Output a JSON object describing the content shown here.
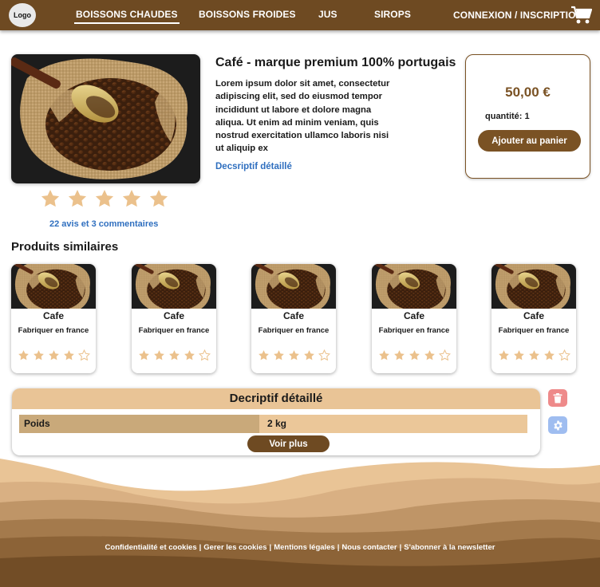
{
  "header": {
    "logo": "Logo",
    "nav": [
      "BOISSONS CHAUDES",
      "BOISSONS FROIDES",
      "JUS",
      "SIROPS"
    ],
    "account": "CONNEXION / INSCRIPTION",
    "cart_icon": "shopping-cart-icon"
  },
  "product": {
    "title": "Café - marque premium 100% portugais",
    "description": "Lorem ipsum dolor sit amet, consectetur adipiscing elit, sed do eiusmod tempor incididunt ut labore et dolore magna aliqua. Ut enim ad minim veniam, quis nostrud exercitation ullamco laboris nisi ut aliquip ex",
    "detail_link": "Decsriptif détaillé",
    "rating": 5,
    "reviews": "22 avis et 3 commentaires",
    "price": "50,00 €",
    "quantity": "quantité: 1",
    "add_to_cart": "Ajouter au panier"
  },
  "similar": {
    "title": "Produits similaires",
    "items": [
      {
        "name": "Cafe",
        "subtitle": "Fabriquer en france",
        "rating": 4
      },
      {
        "name": "Cafe",
        "subtitle": "Fabriquer en france",
        "rating": 4
      },
      {
        "name": "Cafe",
        "subtitle": "Fabriquer en france",
        "rating": 4
      },
      {
        "name": "Cafe",
        "subtitle": "Fabriquer en france",
        "rating": 4
      },
      {
        "name": "Cafe",
        "subtitle": "Fabriquer en france",
        "rating": 4
      }
    ]
  },
  "details": {
    "title": "Decriptif détaillé",
    "rows": [
      {
        "key": "Poids",
        "value": "2 kg"
      }
    ],
    "more": "Voir plus"
  },
  "side_buttons": {
    "delete_icon": "trash-icon",
    "settings_icon": "gear-icon"
  },
  "footer": {
    "links": [
      "Confidentialité et cookies",
      "Gerer les cookies",
      "Mentions légales",
      "Nous contacter",
      "S'abonner à la newsletter"
    ]
  },
  "colors": {
    "header": "#6e4a22",
    "accent": "#7a5224",
    "star": "#ebc18c",
    "link": "#2f6fbf",
    "delete": "#ee8a8a",
    "settings": "#9fbdf0"
  }
}
